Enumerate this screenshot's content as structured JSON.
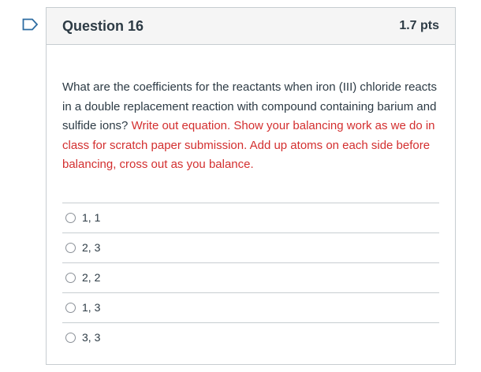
{
  "question": {
    "title": "Question 16",
    "points": "1.7 pts",
    "text_black": "What are the coefficients for the reactants when iron (III) chloride reacts in a double replacement reaction with compound containing barium and sulfide ions?",
    "text_red": "Write out equation.  Show your balancing work as we do in class for scratch paper submission. Add up atoms on each side before balancing, cross out as you balance."
  },
  "answers": [
    {
      "label": "1, 1"
    },
    {
      "label": "2, 3"
    },
    {
      "label": "2, 2"
    },
    {
      "label": "1, 3"
    },
    {
      "label": "3, 3"
    }
  ],
  "colors": {
    "flag_outline": "#2d6ca2",
    "instruction_red": "#d32f2f",
    "header_bg": "#f5f5f5",
    "border": "#c7cdd1"
  },
  "icons": {
    "flag": "bookmark-flag-icon"
  }
}
